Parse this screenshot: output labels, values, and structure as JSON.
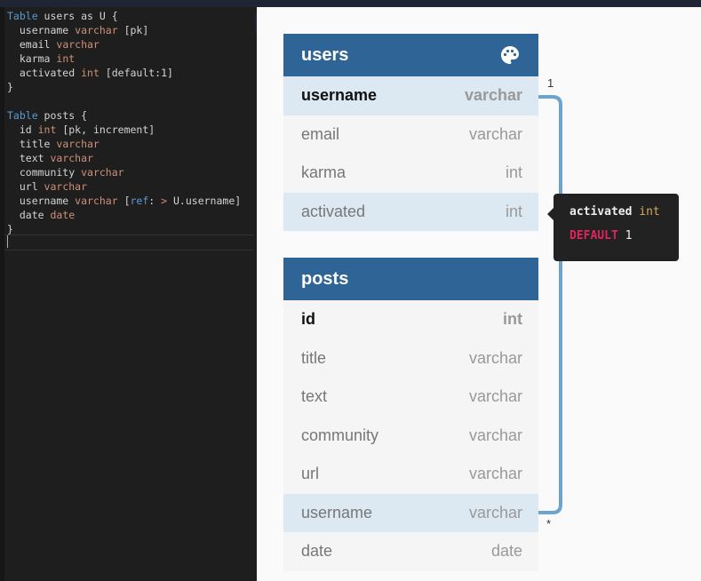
{
  "editor": {
    "lines": [
      [
        {
          "t": "Table",
          "c": "kw"
        },
        {
          "t": " users as U {",
          "c": "op"
        }
      ],
      [
        {
          "t": "  username ",
          "c": "op"
        },
        {
          "t": "varchar",
          "c": "ty"
        },
        {
          "t": " [pk]",
          "c": "op"
        }
      ],
      [
        {
          "t": "  email ",
          "c": "op"
        },
        {
          "t": "varchar",
          "c": "ty"
        }
      ],
      [
        {
          "t": "  karma ",
          "c": "op"
        },
        {
          "t": "int",
          "c": "ty"
        }
      ],
      [
        {
          "t": "  activated ",
          "c": "op"
        },
        {
          "t": "int",
          "c": "ty"
        },
        {
          "t": " [default:1]",
          "c": "op"
        }
      ],
      [
        {
          "t": "}",
          "c": "op"
        }
      ],
      [],
      [
        {
          "t": "Table",
          "c": "kw"
        },
        {
          "t": " posts {",
          "c": "op"
        }
      ],
      [
        {
          "t": "  id ",
          "c": "op"
        },
        {
          "t": "int",
          "c": "ty"
        },
        {
          "t": " [pk, increment]",
          "c": "op"
        }
      ],
      [
        {
          "t": "  title ",
          "c": "op"
        },
        {
          "t": "varchar",
          "c": "ty"
        }
      ],
      [
        {
          "t": "  text ",
          "c": "op"
        },
        {
          "t": "varchar",
          "c": "ty"
        }
      ],
      [
        {
          "t": "  community ",
          "c": "op"
        },
        {
          "t": "varchar",
          "c": "ty"
        }
      ],
      [
        {
          "t": "  url ",
          "c": "op"
        },
        {
          "t": "varchar",
          "c": "ty"
        }
      ],
      [
        {
          "t": "  username ",
          "c": "op"
        },
        {
          "t": "varchar",
          "c": "ty"
        },
        {
          "t": " [",
          "c": "op"
        },
        {
          "t": "ref",
          "c": "kw"
        },
        {
          "t": ": ",
          "c": "op"
        },
        {
          "t": ">",
          "c": "ty"
        },
        {
          "t": " U.username]",
          "c": "op"
        }
      ],
      [
        {
          "t": "  date ",
          "c": "op"
        },
        {
          "t": "date",
          "c": "ty"
        }
      ],
      [
        {
          "t": "}",
          "c": "op"
        }
      ]
    ],
    "collapse_glyph": "‹"
  },
  "tables": {
    "users": {
      "name": "users",
      "fields": [
        {
          "name": "username",
          "type": "varchar"
        },
        {
          "name": "email",
          "type": "varchar"
        },
        {
          "name": "karma",
          "type": "int"
        },
        {
          "name": "activated",
          "type": "int"
        }
      ]
    },
    "posts": {
      "name": "posts",
      "fields": [
        {
          "name": "id",
          "type": "int"
        },
        {
          "name": "title",
          "type": "varchar"
        },
        {
          "name": "text",
          "type": "varchar"
        },
        {
          "name": "community",
          "type": "varchar"
        },
        {
          "name": "url",
          "type": "varchar"
        },
        {
          "name": "username",
          "type": "varchar"
        },
        {
          "name": "date",
          "type": "date"
        }
      ]
    }
  },
  "relation": {
    "from_card": "1",
    "to_card": "*",
    "color": "#6da3d1"
  },
  "tooltip": {
    "field": "activated",
    "type": "int",
    "default_label": "DEFAULT",
    "default_value": "1"
  },
  "colors": {
    "header": "#2f6596",
    "highlight": "#dce9f2",
    "editor_bg": "#1e1e1e"
  }
}
